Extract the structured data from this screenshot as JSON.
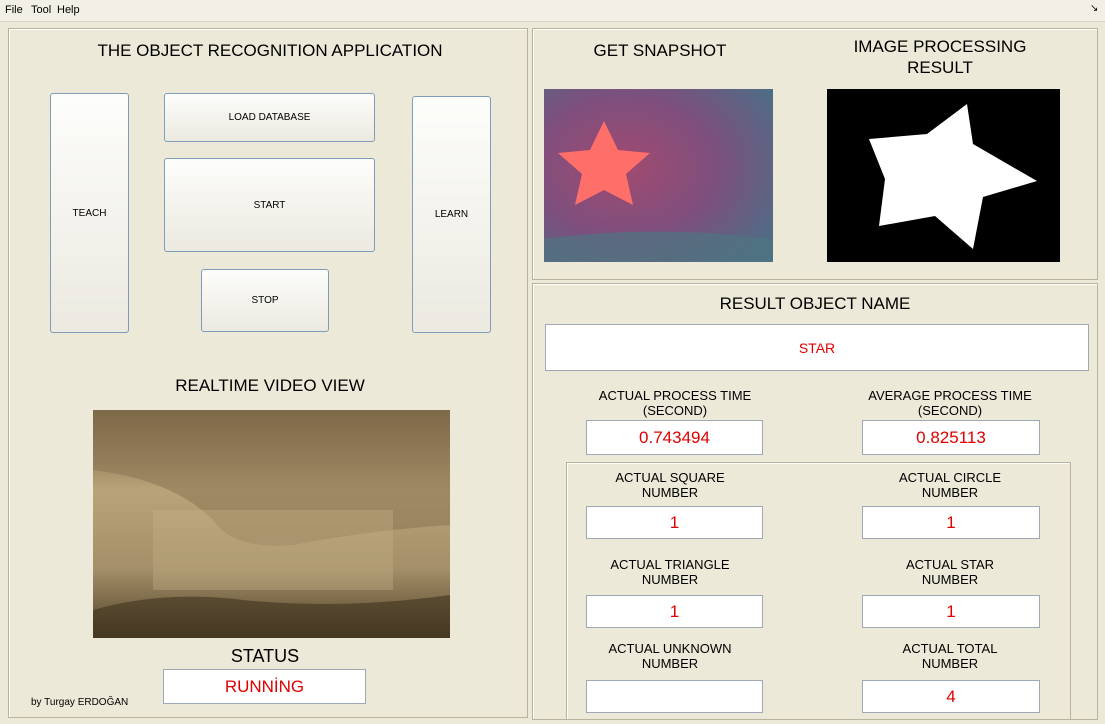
{
  "menu": {
    "file": "File",
    "tool": "Tool",
    "help": "Help"
  },
  "left": {
    "title": "THE OBJECT RECOGNITION APPLICATION",
    "buttons": {
      "teach": "TEACH",
      "load_database": "LOAD DATABASE",
      "start": "START",
      "stop": "STOP",
      "learn": "LEARN"
    },
    "video_title": "REALTIME VIDEO VIEW",
    "status_label": "STATUS",
    "status_value": "RUNNİNG",
    "credit": "by Turgay ERDOĞAN"
  },
  "snapshot": {
    "title": "GET SNAPSHOT",
    "processing_title_line1": "IMAGE PROCESSING",
    "processing_title_line2": "RESULT"
  },
  "result": {
    "title": "RESULT OBJECT NAME",
    "object_name": "STAR",
    "actual_time_label_1": "ACTUAL PROCESS TIME",
    "actual_time_label_2": "(SECOND)",
    "actual_time_value": "0.743494",
    "avg_time_label_1": "AVERAGE PROCESS TIME",
    "avg_time_label_2": "(SECOND)",
    "avg_time_value": "0.825113",
    "square_label_1": "ACTUAL  SQUARE",
    "square_label_2": "NUMBER",
    "square_value": "1",
    "circle_label_1": "ACTUAL CIRCLE",
    "circle_label_2": "NUMBER",
    "circle_value": "1",
    "triangle_label_1": "ACTUAL TRIANGLE",
    "triangle_label_2": "NUMBER",
    "triangle_value": "1",
    "star_label_1": "ACTUAL STAR",
    "star_label_2": "NUMBER",
    "star_value": "1",
    "unknown_label_1": "ACTUAL UNKNOWN",
    "unknown_label_2": "NUMBER",
    "unknown_value": "",
    "total_label_1": "ACTUAL TOTAL",
    "total_label_2": "NUMBER",
    "total_value": "4"
  },
  "colors": {
    "background": "#ece9d8",
    "value_text": "#e00000",
    "button_border": "#7f9db9"
  },
  "icons": {
    "corner": "chevron-down-icon"
  }
}
